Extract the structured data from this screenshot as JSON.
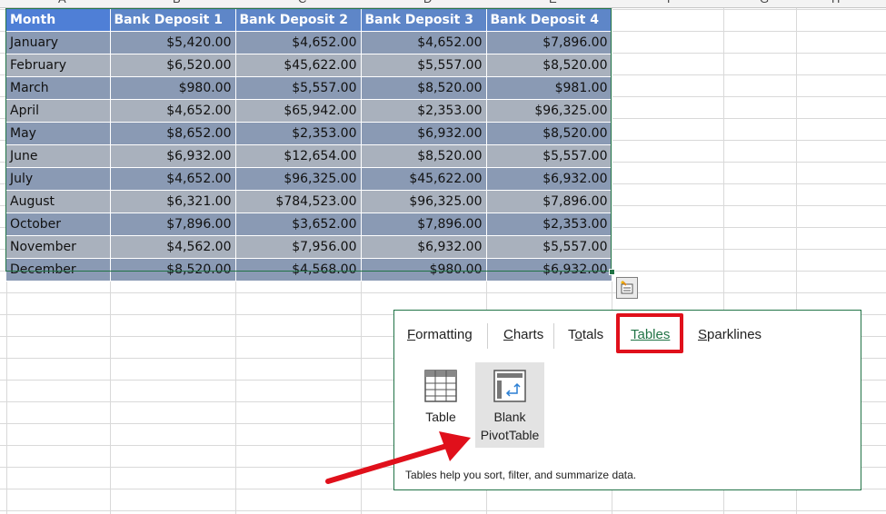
{
  "column_headers": [
    "A",
    "B",
    "C",
    "D",
    "E",
    "F",
    "G",
    "H"
  ],
  "table": {
    "headers": [
      "Month",
      "Bank Deposit 1",
      "Bank Deposit 2",
      "Bank Deposit 3",
      "Bank Deposit 4"
    ],
    "rows": [
      [
        "January",
        "$5,420.00",
        "$4,652.00",
        "$4,652.00",
        "$7,896.00"
      ],
      [
        "February",
        "$6,520.00",
        "$45,622.00",
        "$5,557.00",
        "$8,520.00"
      ],
      [
        "March",
        "$980.00",
        "$5,557.00",
        "$8,520.00",
        "$981.00"
      ],
      [
        "April",
        "$4,652.00",
        "$65,942.00",
        "$2,353.00",
        "$96,325.00"
      ],
      [
        "May",
        "$8,652.00",
        "$2,353.00",
        "$6,932.00",
        "$8,520.00"
      ],
      [
        "June",
        "$6,932.00",
        "$12,654.00",
        "$8,520.00",
        "$5,557.00"
      ],
      [
        "July",
        "$4,652.00",
        "$96,325.00",
        "$45,622.00",
        "$6,932.00"
      ],
      [
        "August",
        "$6,321.00",
        "$784,523.00",
        "$96,325.00",
        "$7,896.00"
      ],
      [
        "October",
        "$7,896.00",
        "$3,652.00",
        "$7,896.00",
        "$2,353.00"
      ],
      [
        "November",
        "$4,562.00",
        "$7,956.00",
        "$6,932.00",
        "$5,557.00"
      ],
      [
        "December",
        "$8,520.00",
        "$4,568.00",
        "$980.00",
        "$6,932.00"
      ]
    ]
  },
  "quick_analysis": {
    "tabs": [
      {
        "key": "F",
        "rest": "ormatting"
      },
      {
        "key": "C",
        "rest": "harts"
      },
      {
        "pre": "T",
        "key": "o",
        "rest": "tals"
      },
      {
        "key": "T",
        "rest": "ables"
      },
      {
        "key": "S",
        "rest": "parklines"
      }
    ],
    "active_tab": "Tables",
    "options": [
      {
        "label": "Table",
        "icon": "table-icon"
      },
      {
        "label_line1": "Blank",
        "label_line2": "PivotTable",
        "icon": "pivot-table-icon"
      }
    ],
    "description": "Tables help you sort, filter, and summarize data."
  },
  "colors": {
    "accent": "#217346",
    "highlight": "#e0101b",
    "header": "#5e86c8",
    "row_odd": "#8a9ab4",
    "row_even": "#a9b1bd"
  }
}
